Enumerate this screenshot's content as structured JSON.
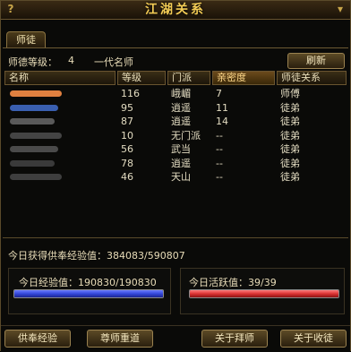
{
  "window": {
    "title": "江湖关系",
    "help_glyph": "?",
    "close_glyph": "▾"
  },
  "tabs": [
    {
      "label": "师徒"
    }
  ],
  "rank": {
    "label": "师德等级：",
    "value": "4",
    "title": "一代名师"
  },
  "refresh_label": "刷新",
  "table": {
    "headers": [
      "名称",
      "等级",
      "门派",
      "亲密度",
      "师徒关系"
    ],
    "sorted_column": "亲密度",
    "rows": [
      {
        "name_color": "#e08040",
        "level": "116",
        "sect": "峨嵋",
        "intimacy": "7",
        "relation": "师傅"
      },
      {
        "name_color": "#3a5fb0",
        "level": "95",
        "sect": "逍遥",
        "intimacy": "11",
        "relation": "徒弟"
      },
      {
        "name_color": "#5a5a5a",
        "level": "87",
        "sect": "逍遥",
        "intimacy": "14",
        "relation": "徒弟"
      },
      {
        "name_color": "#444444",
        "level": "10",
        "sect": "无门派",
        "intimacy": "--",
        "relation": "徒弟"
      },
      {
        "name_color": "#4a4a4a",
        "level": "56",
        "sect": "武当",
        "intimacy": "--",
        "relation": "徒弟"
      },
      {
        "name_color": "#3a3a3a",
        "level": "78",
        "sect": "逍遥",
        "intimacy": "--",
        "relation": "徒弟"
      },
      {
        "name_color": "#3e3e3e",
        "level": "46",
        "sect": "天山",
        "intimacy": "--",
        "relation": "徒弟"
      }
    ]
  },
  "offer": {
    "label": "今日获得供奉经验值：",
    "value": "384083/590807"
  },
  "exp": {
    "label": "今日经验值：",
    "value": "190830/190830",
    "fraction": 1.0,
    "color": "#3347d9"
  },
  "activity": {
    "label": "今日活跃值：",
    "value": "39/39",
    "fraction": 1.0,
    "color": "#d93333"
  },
  "buttons": {
    "offer_exp": "供奉经验",
    "redo_master": "尊师重道",
    "about_master": "关于拜师",
    "about_apprentice": "关于收徒"
  }
}
